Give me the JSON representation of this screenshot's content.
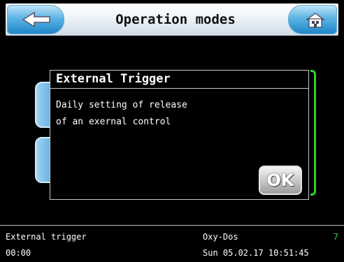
{
  "header": {
    "title": "Operation modes",
    "back_icon": "back-arrow-icon",
    "home_icon": "home-icon"
  },
  "dialog": {
    "title": "External Trigger",
    "lines": [
      "Daily setting of release",
      "of an exernal control"
    ],
    "ok_label": "OK"
  },
  "status": {
    "mode": "External trigger",
    "time": "00:00",
    "product": "Oxy-Dos",
    "indicator": "7",
    "datetime": "Sun 05.02.17 10:51:45"
  },
  "colors": {
    "accent_blue": "#2d96d6",
    "status_green": "#37d137",
    "background": "#000000"
  }
}
